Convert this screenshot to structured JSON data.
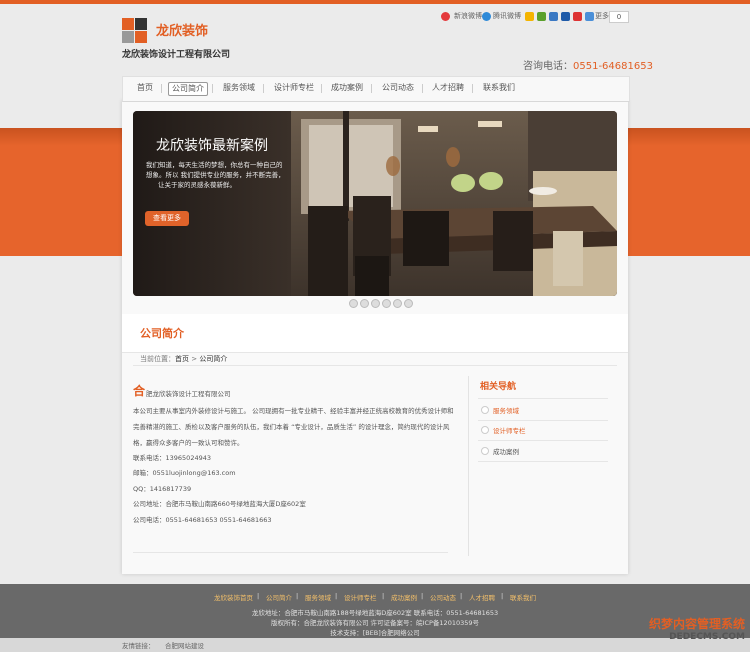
{
  "header": {
    "logo_text": "龙欣装饰",
    "logo_sub": "龙欣装饰设计工程有限公司",
    "share": {
      "weibo": "新浪微博",
      "tweibo": "腾讯微博",
      "more": "更多",
      "count": "0"
    },
    "tel_label": "咨询电话：",
    "tel": "0551-64681653"
  },
  "nav": {
    "items": [
      {
        "label": "首页"
      },
      {
        "label": "公司简介",
        "active": true
      },
      {
        "label": "服务领域"
      },
      {
        "label": "设计师专栏"
      },
      {
        "label": "成功案例"
      },
      {
        "label": "公司动态"
      },
      {
        "label": "人才招聘"
      },
      {
        "label": "联系我们"
      }
    ]
  },
  "banner": {
    "title": "龙欣装饰最新案例",
    "lines": [
      "我们知道，每天生活的梦想，你总有一种自己的",
      "想象。所以 我们提供专业的服务，并不断完善，",
      "让关于家的灵感永葆新鲜。"
    ],
    "button": "查看更多",
    "slides": 6,
    "active_slide": 1
  },
  "section": {
    "title": "公司简介",
    "crumb_prefix": "当前位置：",
    "crumb_home": "首页",
    "crumb_sep": " > ",
    "crumb_current": "公司简介"
  },
  "intro": {
    "first_char": "合",
    "first_line": "肥龙欣装饰设计工程有限公司",
    "para": [
      "本公司主要从事室内外装修设计与施工。 公司现拥有一批专业精干、经验丰富并经正统高校教育的优秀设计师和",
      "完善精湛的施工、质检以及客户服务的队伍，我们本着 “专业设计，品质生活” 的设计理念，简约现代的设计风",
      "格，赢得众多客户的一致认可和赞许。"
    ],
    "contacts": [
      "联系电话：13965024943",
      " 邮箱：0551luojinlong@163.com",
      "QQ：1416817739",
      "公司地址：合肥市马鞍山南路660号绿地蓝海大厦D座602室",
      "公司电话：0551-64681653     0551-64681663"
    ]
  },
  "sidebar": {
    "title": "相关导航",
    "items": [
      {
        "label": "服务领域",
        "active": true
      },
      {
        "label": "设计师专栏",
        "active": true
      },
      {
        "label": "成功案例",
        "active": false
      }
    ]
  },
  "footer": {
    "links": [
      "龙欣装饰首页",
      "公司简介",
      "服务领域",
      "设计师专栏",
      "成功案例",
      "公司动态",
      "人才招聘",
      "联系我们"
    ],
    "address": "龙欣地址：合肥市马鞍山南路188号绿地蓝海D座602室 联系电话：0551-64681653",
    "copyright": "版权所有：合肥龙欣装饰有限公司 许可证备案号：皖ICP备12010359号",
    "support": "技术支持：[BEB]合肥网络公司",
    "friends_label": "友情链接：",
    "friends_link": "合肥网站建设",
    "watermark1": "织梦内容管理系统",
    "watermark2": "DEDECMS.COM"
  },
  "colors": {
    "accent": "#e25f24",
    "footer": "#696969",
    "link": "#f4c06a"
  }
}
